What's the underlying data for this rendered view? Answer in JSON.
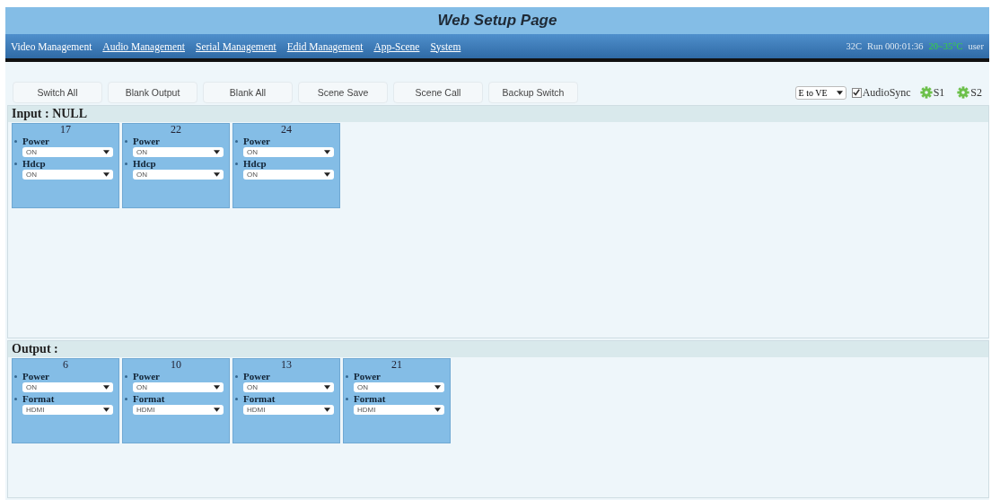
{
  "title": "Web Setup Page",
  "nav": [
    {
      "label": "Video Management",
      "selected": true
    },
    {
      "label": "Audio Management",
      "selected": false
    },
    {
      "label": "Serial Management",
      "selected": false
    },
    {
      "label": "Edid Management",
      "selected": false
    },
    {
      "label": "App-Scene",
      "selected": false
    },
    {
      "label": "System",
      "selected": false
    }
  ],
  "status": {
    "temperature": "32C",
    "run_time": "Run 000:01:36",
    "range": "20~35°C",
    "user": "user"
  },
  "toolbar": [
    "Switch All",
    "Blank Output",
    "Blank All",
    "Scene Save",
    "Scene Call",
    "Backup Switch"
  ],
  "mode_select": {
    "value": "E to VE"
  },
  "audio_sync": {
    "label": "AudioSync",
    "checked": true
  },
  "scenes": [
    "S1",
    "S2"
  ],
  "sections": [
    {
      "title": "Input : NULL",
      "cards": [
        {
          "number": "17",
          "fields": [
            {
              "label": "Power",
              "value": "ON"
            },
            {
              "label": "Hdcp",
              "value": "ON"
            }
          ]
        },
        {
          "number": "22",
          "fields": [
            {
              "label": "Power",
              "value": "ON"
            },
            {
              "label": "Hdcp",
              "value": "ON"
            }
          ]
        },
        {
          "number": "24",
          "fields": [
            {
              "label": "Power",
              "value": "ON"
            },
            {
              "label": "Hdcp",
              "value": "ON"
            }
          ]
        }
      ]
    },
    {
      "title": "Output :",
      "cards": [
        {
          "number": "6",
          "fields": [
            {
              "label": "Power",
              "value": "ON"
            },
            {
              "label": "Format",
              "value": "HDMI"
            }
          ]
        },
        {
          "number": "10",
          "fields": [
            {
              "label": "Power",
              "value": "ON"
            },
            {
              "label": "Format",
              "value": "HDMI"
            }
          ]
        },
        {
          "number": "13",
          "fields": [
            {
              "label": "Power",
              "value": "ON"
            },
            {
              "label": "Format",
              "value": "HDMI"
            }
          ]
        },
        {
          "number": "21",
          "fields": [
            {
              "label": "Power",
              "value": "ON"
            },
            {
              "label": "Format",
              "value": "HDMI"
            }
          ]
        }
      ]
    }
  ]
}
